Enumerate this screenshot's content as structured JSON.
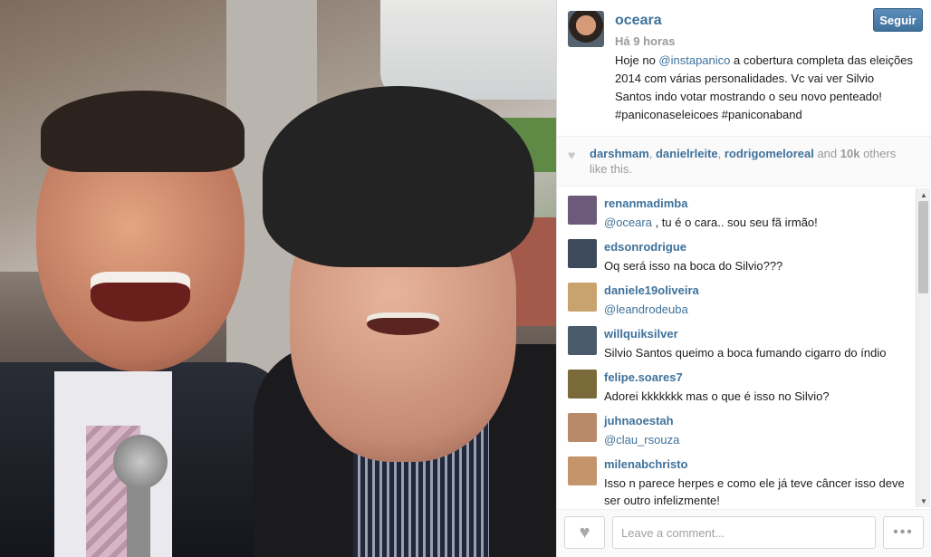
{
  "post": {
    "username": "oceara",
    "timestamp": "Há 9 horas",
    "follow_label": "Seguir",
    "caption_before": "Hoje no ",
    "caption_mention": "@instapanico",
    "caption_after": " a cobertura completa das eleições 2014 com várias personalidades. Vc vai ver Silvio Santos indo votar mostrando o seu novo penteado! #paniconaseleicoes #paniconaband"
  },
  "likes": {
    "users": [
      "darshmam",
      "danielrleite",
      "rodrigomeloreal"
    ],
    "sep1": ", ",
    "sep2": ", ",
    "and_text": " and ",
    "count": "10k",
    "suffix": " others like this."
  },
  "comments": [
    {
      "user": "renanmadimba",
      "mention": "@oceara",
      "text": " , tu é o cara.. sou seu fã irmão!",
      "avatar_color": "#6b5a7a"
    },
    {
      "user": "edsonrodrigue",
      "mention": "",
      "text": "Oq será isso na boca do Silvio???",
      "avatar_color": "#3d4a5c"
    },
    {
      "user": "daniele19oliveira",
      "mention": "@leandrodeuba",
      "text": "",
      "avatar_color": "#c9a36d"
    },
    {
      "user": "willquiksilver",
      "mention": "",
      "text": "Silvio Santos queimo a boca fumando cigarro do índio",
      "avatar_color": "#4a5a6a"
    },
    {
      "user": "felipe.soares7",
      "mention": "",
      "text": "Adorei kkkkkkk mas o que é isso no Silvio?",
      "avatar_color": "#7a6a3a"
    },
    {
      "user": "juhnaoestah",
      "mention": "@clau_rsouza",
      "text": "",
      "avatar_color": "#b98a6a"
    },
    {
      "user": "milenabchristo",
      "mention": "",
      "text": "Isso n parece herpes e como ele já teve câncer isso deve ser outro infelizmente!",
      "avatar_color": "#c4946a"
    }
  ],
  "footer": {
    "comment_placeholder": "Leave a comment...",
    "like_icon": "heart-icon",
    "more_icon": "ellipsis-icon",
    "more_label": "•••"
  },
  "colors": {
    "link": "#3f729b",
    "follow_button": "#3f729b"
  }
}
